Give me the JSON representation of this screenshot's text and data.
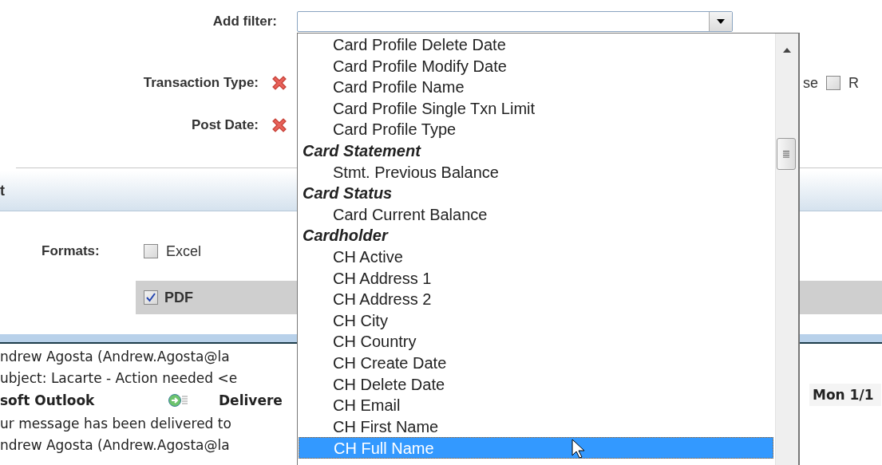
{
  "filter": {
    "label": "Add filter:"
  },
  "filters": [
    {
      "label": "Transaction Type:"
    },
    {
      "label": "Post Date:"
    }
  ],
  "right_fragment": {
    "text": "se",
    "checked": false,
    "label": "R"
  },
  "section": {
    "title": "t"
  },
  "formats": {
    "label": "Formats:",
    "options": [
      {
        "label": "Excel",
        "checked": false
      },
      {
        "label": "PDF",
        "checked": true
      }
    ]
  },
  "email": {
    "lines": [
      "ndrew Agosta (Andrew.Agosta@la",
      "ubject: Lacarte - Action needed <e"
    ],
    "sender": "soft Outlook",
    "status": "Delivere",
    "date": "Mon 1/1",
    "body": [
      "ur message has been delivered to",
      "ndrew Agosta (Andrew.Agosta@la"
    ]
  },
  "dropdown": {
    "items": [
      {
        "kind": "item",
        "label": "Card Profile Delete Date",
        "selected": false
      },
      {
        "kind": "item",
        "label": "Card Profile Modify Date",
        "selected": false
      },
      {
        "kind": "item",
        "label": "Card Profile Name",
        "selected": false
      },
      {
        "kind": "item",
        "label": "Card Profile Single Txn Limit",
        "selected": false
      },
      {
        "kind": "item",
        "label": "Card Profile Type",
        "selected": false
      },
      {
        "kind": "group",
        "label": "Card Statement",
        "selected": false
      },
      {
        "kind": "item",
        "label": "Stmt. Previous Balance",
        "selected": false
      },
      {
        "kind": "group",
        "label": "Card Status",
        "selected": false
      },
      {
        "kind": "item",
        "label": "Card Current Balance",
        "selected": false
      },
      {
        "kind": "group",
        "label": "Cardholder",
        "selected": false
      },
      {
        "kind": "item",
        "label": "CH Active",
        "selected": false
      },
      {
        "kind": "item",
        "label": "CH Address 1",
        "selected": false
      },
      {
        "kind": "item",
        "label": "CH Address 2",
        "selected": false
      },
      {
        "kind": "item",
        "label": "CH City",
        "selected": false
      },
      {
        "kind": "item",
        "label": "CH Country",
        "selected": false
      },
      {
        "kind": "item",
        "label": "CH Create Date",
        "selected": false
      },
      {
        "kind": "item",
        "label": "CH Delete Date",
        "selected": false
      },
      {
        "kind": "item",
        "label": "CH Email",
        "selected": false
      },
      {
        "kind": "item",
        "label": "CH First Name",
        "selected": false
      },
      {
        "kind": "item",
        "label": "CH Full Name",
        "selected": true
      }
    ]
  }
}
